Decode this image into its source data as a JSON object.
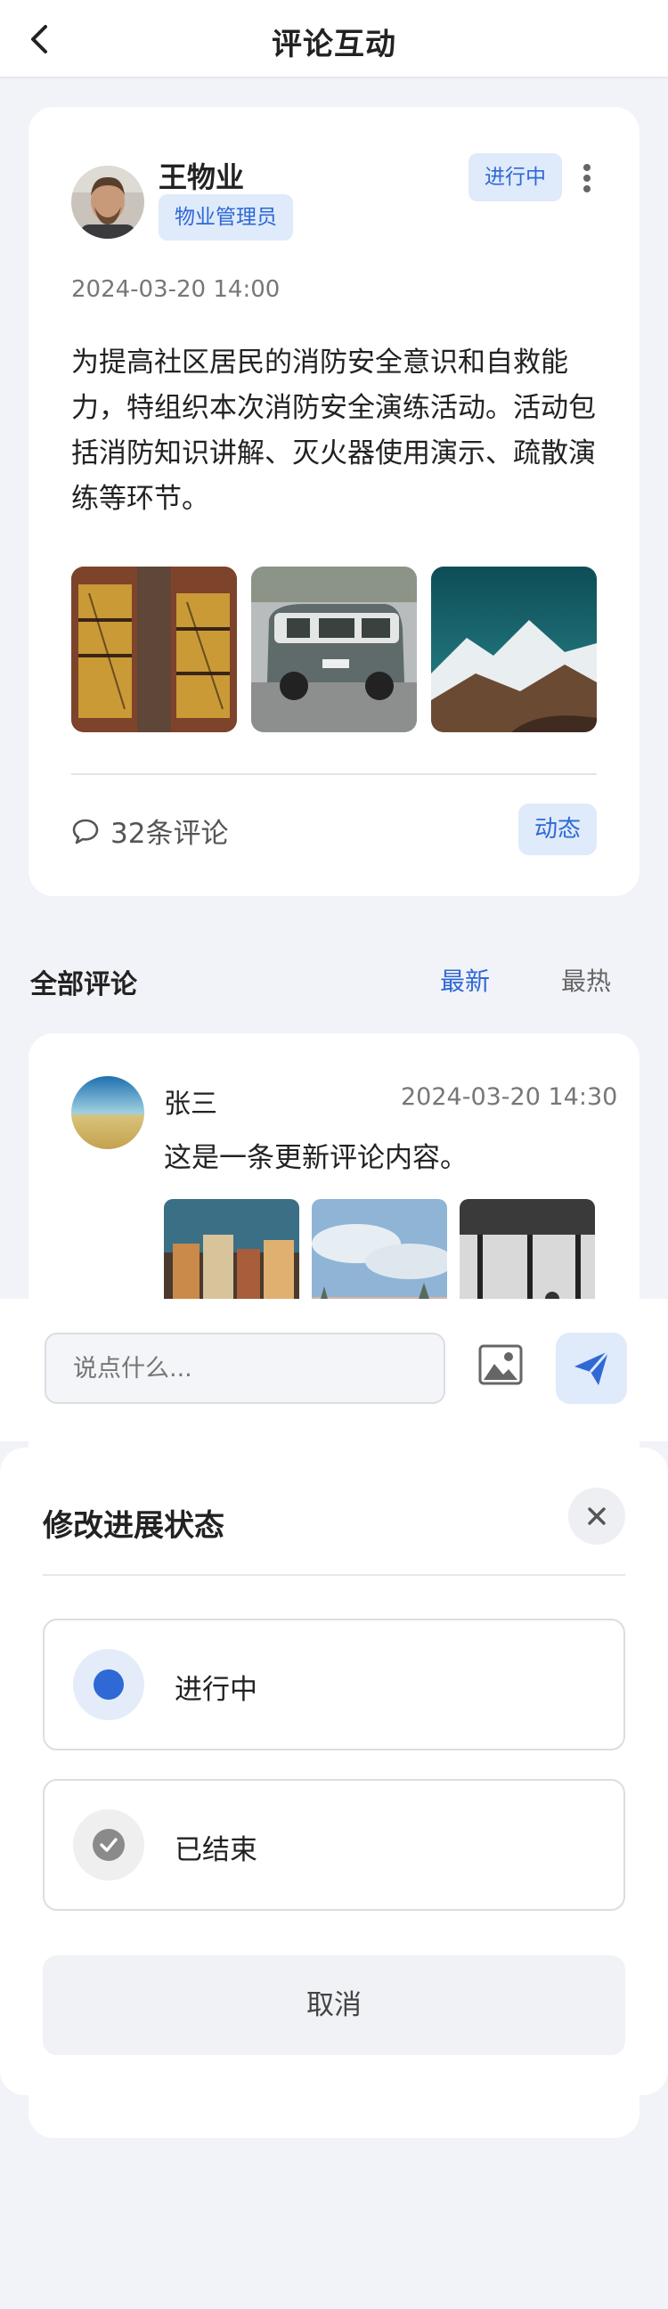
{
  "header": {
    "title": "评论互动",
    "back_icon": "chevron-left-icon"
  },
  "post": {
    "author_name": "王物业",
    "author_role": "物业管理员",
    "status": "进行中",
    "time": "2024-03-20 14:00",
    "content": "为提高社区居民的消防安全意识和自救能力，特组织本次消防安全演练活动。活动包括消防知识讲解、灭火器使用演示、疏散演练等环节。",
    "images": [
      "brick-wall-photo",
      "vintage-van-photo",
      "mountain-lake-photo"
    ],
    "comment_count": "32条评论",
    "tag": "动态"
  },
  "comments_section": {
    "title": "全部评论",
    "sort_latest": "最新",
    "sort_hot": "最热"
  },
  "comment": {
    "name": "张三",
    "time": "2024-03-20 14:30",
    "text": "这是一条更新评论内容。",
    "images": [
      "hillside-town-photo",
      "cloudy-sky-photo",
      "bw-window-photo"
    ]
  },
  "input_bar": {
    "placeholder": "说点什么..."
  },
  "status_sheet": {
    "title": "修改进展状态",
    "options": [
      {
        "label": "进行中",
        "selected": true
      },
      {
        "label": "已结束",
        "selected": false
      }
    ],
    "cancel": "取消"
  },
  "colors": {
    "accent": "#2e69d6",
    "accent_bg": "#dfeafb",
    "page_bg": "#f2f3f8"
  }
}
